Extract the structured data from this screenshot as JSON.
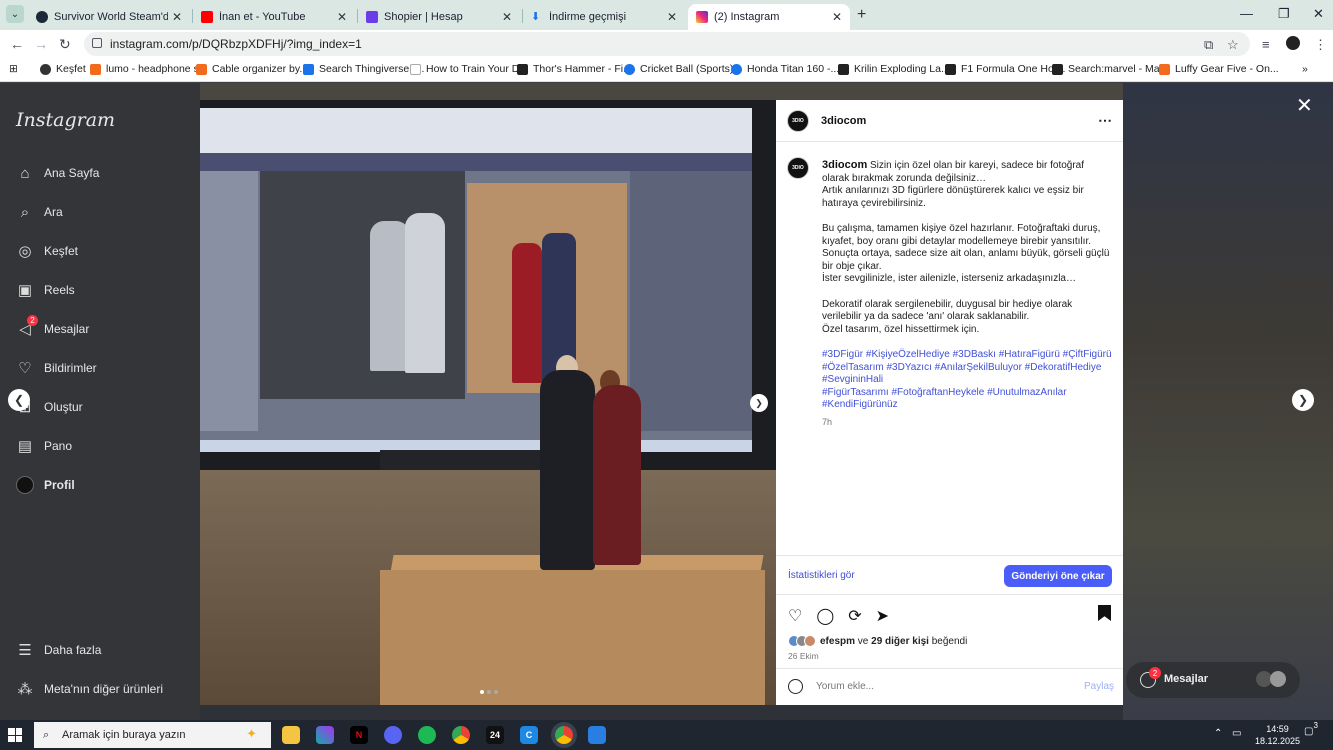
{
  "browser": {
    "tabs": [
      {
        "label": "Survivor World Steam'de",
        "favicon": "steam-icon",
        "color": "#1b2838"
      },
      {
        "label": "İnan et - YouTube",
        "favicon": "youtube-icon",
        "color": "#ff0000"
      },
      {
        "label": "Shopier | Hesap",
        "favicon": "shopier-icon",
        "color": "#6a3de8"
      },
      {
        "label": "İndirme geçmişi",
        "favicon": "download-icon",
        "color": "#1a73e8"
      },
      {
        "label": "(2) Instagram",
        "favicon": "instagram-icon",
        "color": "#e1306c"
      }
    ],
    "url": "instagram.com/p/DQRbzpXDFHj/?img_index=1",
    "bookmarks": [
      {
        "label": "Keşfet"
      },
      {
        "label": "lumo - headphone s..."
      },
      {
        "label": "Cable organizer by..."
      },
      {
        "label": "Search Thingiverse -..."
      },
      {
        "label": "How to Train Your D..."
      },
      {
        "label": "Thor's Hammer - Fi..."
      },
      {
        "label": "Cricket Ball (Sports)..."
      },
      {
        "label": "Honda Titan 160 -..."
      },
      {
        "label": "Krilin Exploding La..."
      },
      {
        "label": "F1 Formula One Hot..."
      },
      {
        "label": "Search:marvel - Ma..."
      },
      {
        "label": "Luffy Gear Five - On..."
      }
    ]
  },
  "sidebar": {
    "logo": "Instagram",
    "items": [
      {
        "label": "Ana Sayfa",
        "icon": "home-icon"
      },
      {
        "label": "Ara",
        "icon": "search-icon"
      },
      {
        "label": "Keşfet",
        "icon": "compass-icon"
      },
      {
        "label": "Reels",
        "icon": "reels-icon"
      },
      {
        "label": "Mesajlar",
        "icon": "messages-icon",
        "badge": "2"
      },
      {
        "label": "Bildirimler",
        "icon": "heart-icon"
      },
      {
        "label": "Oluştur",
        "icon": "plus-icon"
      },
      {
        "label": "Pano",
        "icon": "dashboard-icon"
      },
      {
        "label": "Profil",
        "icon": "avatar-icon"
      }
    ],
    "more": "Daha fazla",
    "meta": "Meta'nın diğer ürünleri"
  },
  "post": {
    "username": "3diocom",
    "avatar_text": "3DIO",
    "caption_lines": [
      "Sizin için özel olan bir kareyi, sadece bir fotoğraf olarak bırakmak zorunda değilsiniz…",
      "Artık anılarınızı 3D figürlere dönüştürerek kalıcı ve eşsiz bir hatıraya çevirebilirsiniz.",
      "",
      "Bu çalışma, tamamen kişiye özel hazırlanır. Fotoğraftaki duruş, kıyafet, boy oranı gibi detaylar modellemeye birebir yansıtılır.",
      "Sonuçta ortaya, sadece size ait olan, anlamı büyük, görseli güçlü bir obje çıkar.",
      "İster sevgilinizle, ister ailenizle, isterseniz arkadaşınızla…",
      "",
      "Dekoratif olarak sergilenebilir, duygusal bir hediye olarak verilebilir ya da sadece 'anı' olarak saklanabilir.",
      "Özel tasarım, özel hissettirmek için.",
      ""
    ],
    "hashtags_1": "#3DFigür #KişiyeÖzelHediye #3DBaskı #HatıraFigürü #ÇiftFigürü #ÖzelTasarım #3DYazıcı #AnılarŞekilBuluyor #DekoratifHediye #SevgininHali",
    "hashtags_2": "#FigürTasarımı #FotoğraftanHeykele #UnutulmazAnılar #KendiFigürünüz",
    "time": "7h",
    "stats_link": "İstatistikleri gör",
    "boost_button": "Gönderiyi öne çıkar",
    "likes_user": "efespm",
    "likes_and": "ve",
    "likes_count": "29 diğer kişi",
    "likes_suffix": "beğendi",
    "date": "26 Ekim",
    "comment_placeholder": "Yorum ekle...",
    "post_button": "Paylaş"
  },
  "messages_pill": {
    "label": "Mesajlar",
    "badge": "2"
  },
  "taskbar": {
    "search_placeholder": "Aramak için buraya yazın",
    "time": "14:59",
    "date": "18.12.2025",
    "notif_count": "3"
  }
}
